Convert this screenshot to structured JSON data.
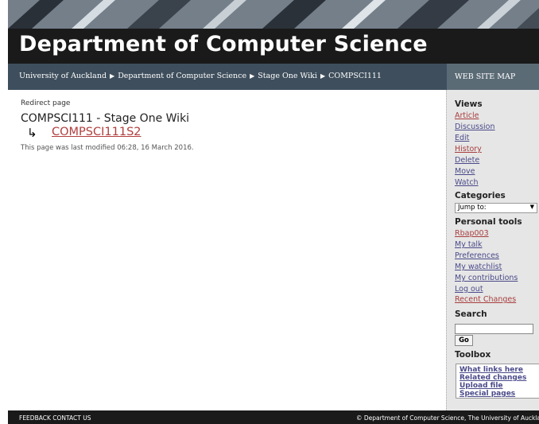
{
  "banner": {
    "title": "Department of Computer Science"
  },
  "breadcrumb": [
    "University of Auckland",
    "Department of Computer Science",
    "Stage One Wiki",
    "COMPSCI111"
  ],
  "sitemap_label": "WEB SITE MAP",
  "main": {
    "redirect_label": "Redirect page",
    "heading": "COMPSCI111 - Stage One Wiki",
    "redirect_arrow": "↳",
    "redirect_link": "COMPSCI111S2",
    "last_modified": "This page was last modified 06:28, 16 March 2016."
  },
  "sidebar": {
    "views_heading": "Views",
    "views": [
      "Article",
      "Discussion",
      "Edit",
      "History",
      "Delete",
      "Move",
      "Watch"
    ],
    "categories_heading": "Categories",
    "jump_value": "Jump to:",
    "personal_heading": "Personal tools",
    "personal": [
      "Rbap003",
      "My talk",
      "Preferences",
      "My watchlist",
      "My contributions",
      "Log out",
      "Recent Changes"
    ],
    "search_heading": "Search",
    "go_label": "Go",
    "toolbox_heading": "Toolbox",
    "toolbox": [
      "What links here",
      "Related changes",
      "Upload file",
      "Special pages"
    ]
  },
  "footer": {
    "left": "FEEDBACK  CONTACT US",
    "right": "© Department of Computer Science, The University of Auckland"
  }
}
